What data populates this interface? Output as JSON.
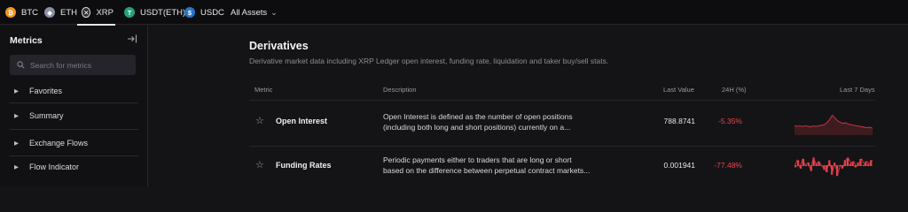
{
  "tabs": [
    {
      "label": "BTC",
      "icon": "bitcoin-icon",
      "color": "#f7931a",
      "glyph": "₿",
      "active": false
    },
    {
      "label": "ETH",
      "icon": "ethereum-icon",
      "color": "#8a8fa3",
      "glyph": "◆",
      "active": false
    },
    {
      "label": "XRP",
      "icon": "xrp-icon",
      "color": "#2a2a2f",
      "glyph": "✕",
      "active": true
    },
    {
      "label": "USDT(ETH)",
      "icon": "tether-icon",
      "color": "#26a17b",
      "glyph": "T",
      "active": false
    },
    {
      "label": "USDC",
      "icon": "usdc-icon",
      "color": "#2775ca",
      "glyph": "$",
      "active": false
    }
  ],
  "all_assets": {
    "label": "All Assets"
  },
  "sidebar": {
    "title": "Metrics",
    "search_placeholder": "Search for metrics",
    "items": [
      {
        "label": "Favorites"
      },
      {
        "label": "Summary"
      },
      {
        "label": "Exchange Flows"
      },
      {
        "label": "Flow Indicator"
      }
    ]
  },
  "section": {
    "title": "Derivatives",
    "description": "Derivative market data including XRP Ledger open interest, funding rate, liquidation and taker buy/sell stats."
  },
  "table": {
    "headers": {
      "metric": "Metric",
      "description": "Description",
      "last_value": "Last Value",
      "change": "24H (%)",
      "last7": "Last 7 Days"
    },
    "rows": [
      {
        "name": "Open Interest",
        "desc1": "Open Interest is defined as the number of open positions",
        "desc2": "(including both long and short positions) currently on a...",
        "value": "788.8741",
        "change": "-5.35%",
        "spark": [
          0.62,
          0.64,
          0.63,
          0.65,
          0.62,
          0.64,
          0.66,
          0.63,
          0.65,
          0.62,
          0.6,
          0.58,
          0.5,
          0.38,
          0.2,
          0.3,
          0.42,
          0.48,
          0.52,
          0.5,
          0.55,
          0.58,
          0.6,
          0.62,
          0.64,
          0.66,
          0.68,
          0.7,
          0.68,
          0.72
        ]
      },
      {
        "name": "Funding Rates",
        "desc1": "Periodic payments either to traders that are long or short",
        "desc2": "based on the difference between perpetual contract markets...",
        "value": "0.001941",
        "change": "-77.48%",
        "spark": [
          0.55,
          0.3,
          0.6,
          0.25,
          0.5,
          0.4,
          0.7,
          0.2,
          0.45,
          0.35,
          0.5,
          0.65,
          0.75,
          0.3,
          0.85,
          0.4,
          0.9,
          0.5,
          0.6,
          0.3,
          0.2,
          0.45,
          0.35,
          0.55,
          0.4,
          0.25,
          0.5,
          0.35,
          0.45,
          0.3
        ]
      }
    ]
  },
  "colors": {
    "negative": "#f0414f",
    "spark_line": "#d13a44",
    "spark_fill": "#5a1f25"
  }
}
